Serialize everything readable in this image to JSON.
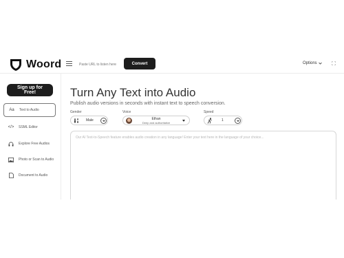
{
  "header": {
    "brand": "Woord",
    "url_placeholder": "Paste URL to listen here",
    "convert_label": "Convert",
    "options_label": "Options"
  },
  "sidebar": {
    "signup_label": "Sign up for Free!",
    "items": [
      {
        "label": "Text to Audio",
        "icon": "text-aa-icon",
        "active": true
      },
      {
        "label": "SSML Editor",
        "icon": "code-icon",
        "active": false
      },
      {
        "label": "Explore Free Audios",
        "icon": "headphones-icon",
        "active": false
      },
      {
        "label": "Photo or Scan to Audio",
        "icon": "image-icon",
        "active": false
      },
      {
        "label": "Document to Audio",
        "icon": "document-icon",
        "active": false
      }
    ]
  },
  "main": {
    "title": "Turn Any Text into Audio",
    "subtitle": "Publish audio versions in seconds with instant text to speech conversion.",
    "gender": {
      "label": "Gender",
      "value": "Male"
    },
    "voice": {
      "label": "Voice",
      "name": "Ethan",
      "description": "Deep and authoritative"
    },
    "speed": {
      "label": "Speed",
      "value": "1"
    },
    "text_placeholder": "Our AI Text-to-Speech feature enables audio creation in any language! Enter your text here in the language of your choice..."
  }
}
